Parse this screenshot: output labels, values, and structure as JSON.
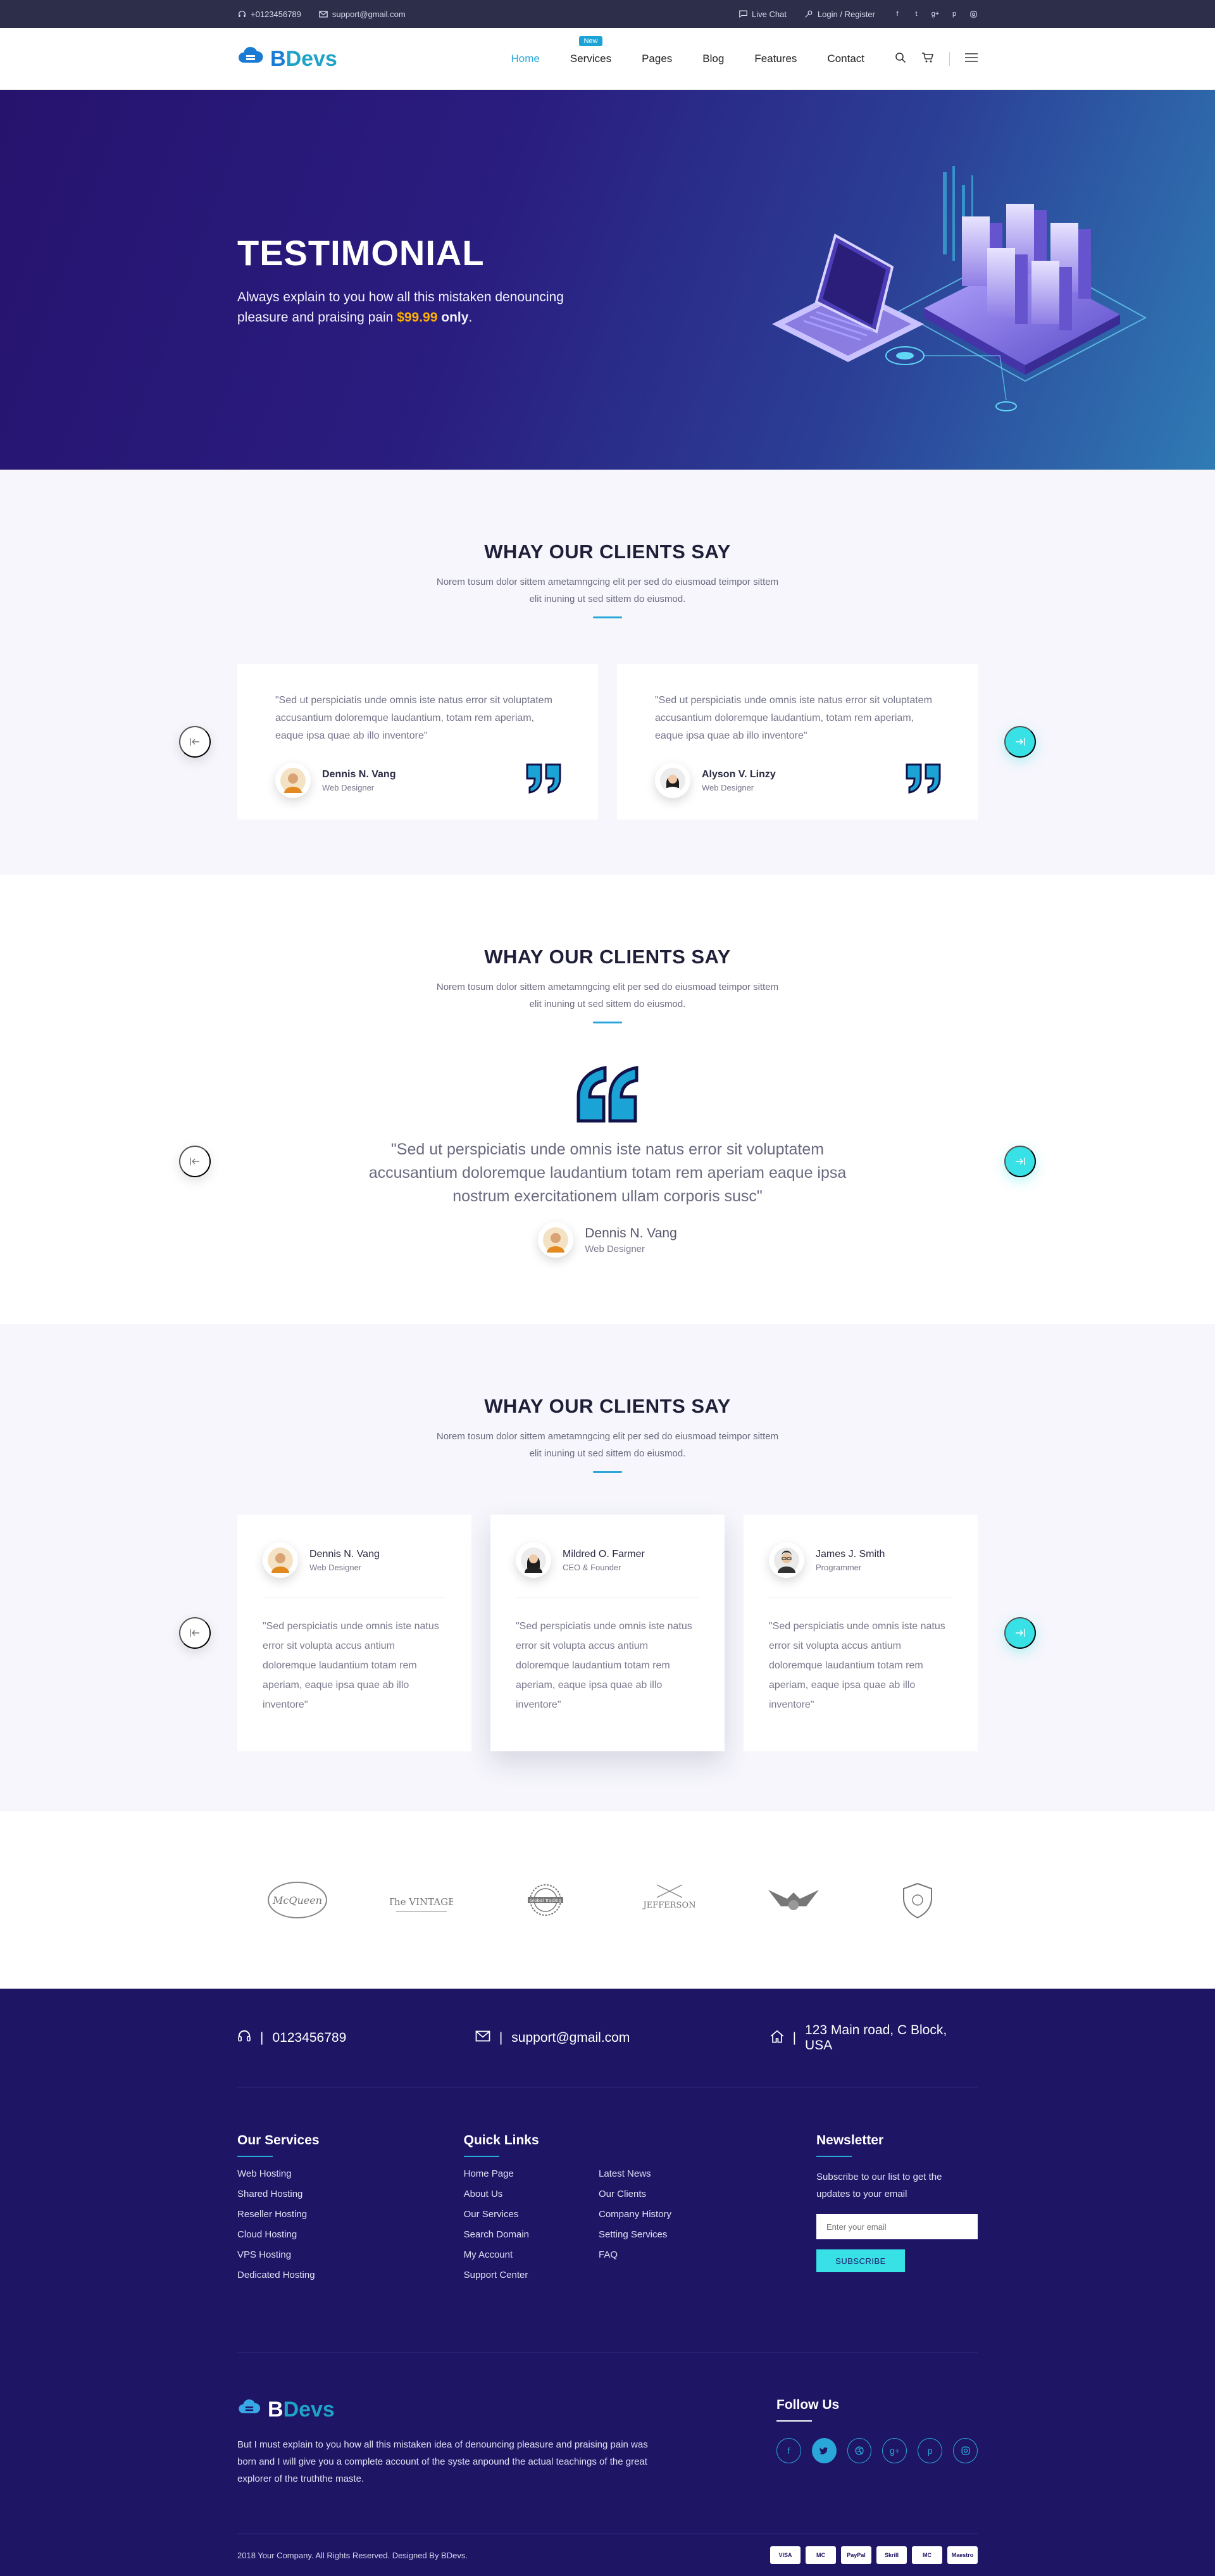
{
  "topbar": {
    "phone": "+0123456789",
    "email": "support@gmail.com",
    "live_chat": "Live Chat",
    "login": "Login / Register"
  },
  "nav": {
    "logo_b": "B",
    "logo_devs": "Devs",
    "items": [
      "Home",
      "Services",
      "Pages",
      "Blog",
      "Features",
      "Contact"
    ],
    "badge": "New"
  },
  "hero": {
    "title": "TESTIMONIAL",
    "sub_1": "Always explain to you how all this mistaken denouncing pleasure and praising pain ",
    "price": "$99.99",
    "only": " only",
    "end": "."
  },
  "section1": {
    "title": "WHAY OUR CLIENTS SAY",
    "sub": "Norem tosum dolor sittem ametamngcing elit per sed do eiusmoad teimpor sittem elit inuning ut sed sittem do eiusmod.",
    "cards": [
      {
        "quote": "\"Sed ut perspiciatis unde omnis iste natus error sit voluptatem accusantium doloremque laudantium, totam rem aperiam, eaque ipsa quae ab illo inventore\"",
        "name": "Dennis N. Vang",
        "role": "Web Designer"
      },
      {
        "quote": "\"Sed ut perspiciatis unde omnis iste natus error sit voluptatem accusantium doloremque laudantium, totam rem aperiam, eaque ipsa quae ab illo inventore\"",
        "name": "Alyson V. Linzy",
        "role": "Web Designer"
      }
    ]
  },
  "section2": {
    "title": "WHAY OUR CLIENTS SAY",
    "sub": "Norem tosum dolor sittem ametamngcing elit per sed do eiusmoad teimpor sittem elit inuning ut sed sittem do eiusmod.",
    "quote": "\"Sed ut perspiciatis unde omnis iste natus error sit voluptatem accusantium doloremque laudantium totam rem aperiam eaque ipsa nostrum exercitationem ullam corporis susc\"",
    "name": "Dennis N. Vang",
    "role": "Web Designer"
  },
  "section3": {
    "title": "WHAY OUR CLIENTS SAY",
    "sub": "Norem tosum dolor sittem ametamngcing elit per sed do eiusmoad teimpor sittem elit inuning ut sed sittem do eiusmod.",
    "cards": [
      {
        "name": "Dennis N. Vang",
        "role": "Web Designer",
        "quote": "\"Sed perspiciatis unde omnis iste natus error sit volupta accus antium doloremque laudantium totam rem aperiam, eaque ipsa quae ab illo inventore\""
      },
      {
        "name": "Mildred O. Farmer",
        "role": "CEO & Founder",
        "quote": "\"Sed perspiciatis unde omnis iste natus error sit volupta accus antium doloremque laudantium totam rem aperiam, eaque ipsa quae ab illo inventore\""
      },
      {
        "name": "James J. Smith",
        "role": "Programmer",
        "quote": "\"Sed perspiciatis unde omnis iste natus error sit volupta accus antium doloremque laudantium totam rem aperiam, eaque ipsa quae ab illo inventore\""
      }
    ]
  },
  "brands": [
    "McQueen",
    "The VINTAGE",
    "Global Trading",
    "JEFFERSON",
    "Eagle",
    "Shield"
  ],
  "footer": {
    "phone": "0123456789",
    "email": "support@gmail.com",
    "address": "123 Main road, C Block, USA",
    "services_title": "Our Services",
    "services": [
      "Web Hosting",
      "Shared Hosting",
      "Reseller Hosting",
      "Cloud Hosting",
      "VPS Hosting",
      "Dedicated Hosting"
    ],
    "links_title": "Quick Links",
    "links_1": [
      "Home Page",
      "About Us",
      "Our Services",
      "Search Domain",
      "My Account",
      "Support Center"
    ],
    "links_2": [
      "Latest News",
      "Our Clients",
      "Company History",
      "Setting Services",
      "FAQ"
    ],
    "news_title": "Newsletter",
    "news_text": "Subscribe to our list to get the updates to your email",
    "news_placeholder": "Enter your email",
    "news_btn": "SUBSCRIBE",
    "about_logo_b": "B",
    "about_logo_devs": "Devs",
    "about_text": "But I must explain to you how all this mistaken idea of denouncing pleasure and praising pain was born and I will give you a complete account of the syste anpound the actual teachings of the great explorer of the truththe maste.",
    "follow_title": "Follow Us",
    "copyright": "2018 Your Company. All Rights Reserved. Designed By BDevs.",
    "payments": [
      "VISA",
      "MC",
      "PayPal",
      "Skrill",
      "MC",
      "Maestro"
    ]
  },
  "colors": {
    "accent": "#2aa7d9",
    "cyan": "#37e1e6",
    "footer_bg": "#1e1565",
    "price": "#ffb200"
  }
}
